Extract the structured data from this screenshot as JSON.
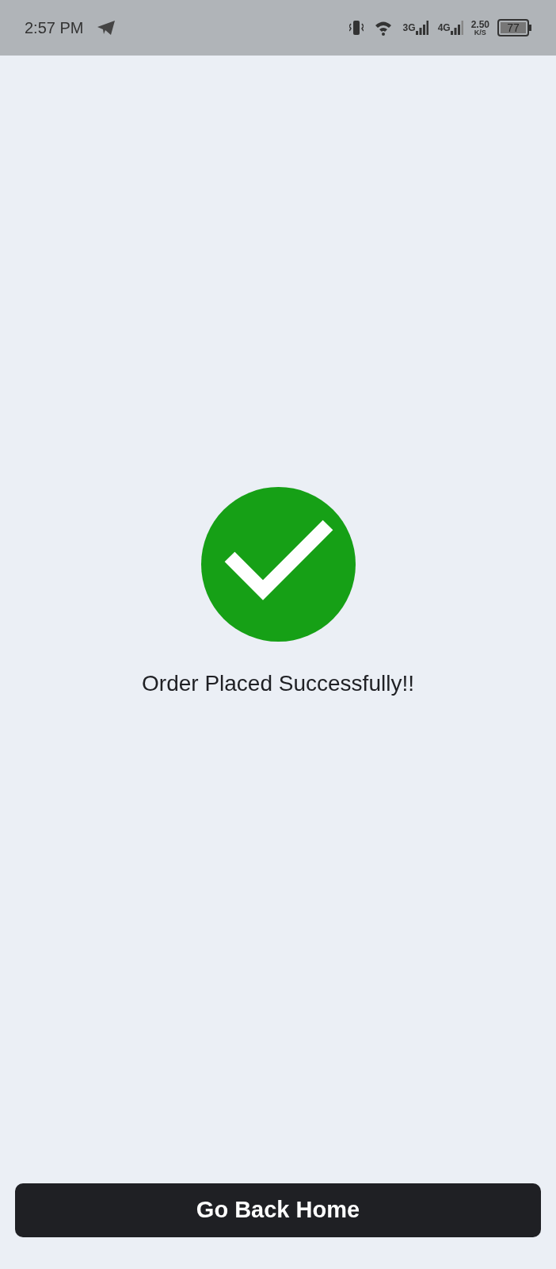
{
  "status_bar": {
    "time": "2:57 PM",
    "network_labels": [
      "3G",
      "4G"
    ],
    "speed": "2.50",
    "speed_unit": "K/S",
    "battery": "77"
  },
  "message": "Order Placed Successfully!!",
  "button": {
    "label": "Go Back Home"
  }
}
